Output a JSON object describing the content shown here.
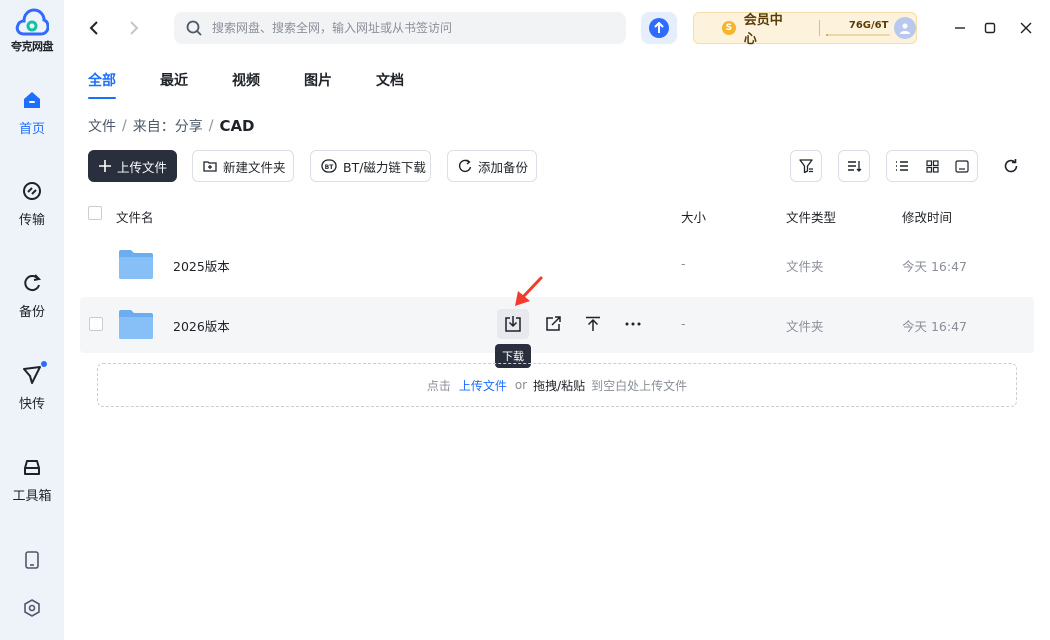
{
  "app": {
    "name": "夸克网盘"
  },
  "sidebar": {
    "items": [
      {
        "label": "首页",
        "icon": "home-icon",
        "active": true
      },
      {
        "label": "传输",
        "icon": "transfer-icon"
      },
      {
        "label": "备份",
        "icon": "backup-icon"
      },
      {
        "label": "快传",
        "icon": "quick-send-icon",
        "badge": true
      },
      {
        "label": "工具箱",
        "icon": "toolbox-icon"
      }
    ],
    "bottom": [
      {
        "icon": "phone-icon"
      },
      {
        "icon": "settings-icon"
      }
    ]
  },
  "topbar": {
    "search_placeholder": "搜索网盘、搜索全网，输入网址或从书签访问",
    "vip_coin": "S",
    "vip_label": "会员中心",
    "storage_text": "76G/6T",
    "storage_used_fraction": 0.012
  },
  "tabs": [
    {
      "label": "全部",
      "active": true
    },
    {
      "label": "最近"
    },
    {
      "label": "视频"
    },
    {
      "label": "图片"
    },
    {
      "label": "文档"
    }
  ],
  "breadcrumb": {
    "items": [
      "文件",
      "来自：分享"
    ],
    "current": "CAD"
  },
  "toolbar": {
    "upload_label": "上传文件",
    "new_folder_label": "新建文件夹",
    "bt_label": "BT/磁力链下载",
    "backup_label": "添加备份"
  },
  "table": {
    "headers": {
      "name": "文件名",
      "size": "大小",
      "type": "文件类型",
      "modified": "修改时间"
    },
    "rows": [
      {
        "name": "2025版本",
        "size": "-",
        "type": "文件夹",
        "modified": "今天 16:47"
      },
      {
        "name": "2026版本",
        "size": "-",
        "type": "文件夹",
        "modified": "今天 16:47"
      }
    ]
  },
  "tooltip": "下载",
  "dropzone": {
    "prefix": "点击",
    "link": "上传文件",
    "or": "or",
    "strong": "拖拽/粘贴",
    "suffix": "到空白处上传文件"
  },
  "colors": {
    "accent": "#1f6fff",
    "sidebar_bg": "#eef3fa",
    "folder": "#6aaef0",
    "vip_bg": "#fdf3dc"
  }
}
